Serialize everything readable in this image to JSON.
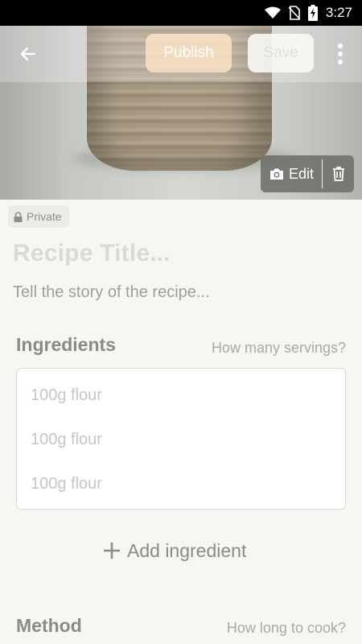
{
  "status_bar": {
    "time": "3:27"
  },
  "header": {
    "publish_label": "Publish",
    "save_label": "Save"
  },
  "photo": {
    "edit_label": "Edit"
  },
  "privacy": {
    "label": "Private"
  },
  "recipe": {
    "title_placeholder": "Recipe Title...",
    "story_placeholder": "Tell the story of the recipe..."
  },
  "ingredients": {
    "heading": "Ingredients",
    "servings_hint": "How many servings?",
    "items": [
      "100g flour",
      "100g flour",
      "100g flour"
    ],
    "add_label": "Add ingredient"
  },
  "method": {
    "heading": "Method",
    "cook_time_hint": "How long to cook?"
  }
}
